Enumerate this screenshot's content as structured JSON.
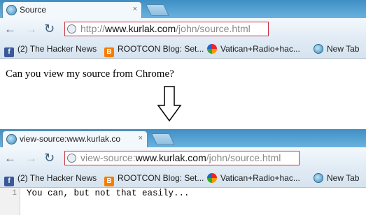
{
  "top_window": {
    "tab": {
      "title": "Source",
      "close": "×"
    },
    "nav": {
      "back": "←",
      "forward": "→",
      "reload": "↻"
    },
    "address": {
      "prefix": "http://",
      "domain": "www.kurlak.com",
      "path": "/john/source.html"
    },
    "bookmarks": [
      {
        "icon": "facebook-icon",
        "label": "(2) The Hacker News"
      },
      {
        "icon": "blogger-icon",
        "label": "ROOTCON Blog: Set..."
      },
      {
        "icon": "picasa-icon",
        "label": "Vatican+Radio+hac..."
      },
      {
        "icon": "globe-icon",
        "label": "New Tab"
      }
    ],
    "page_text": "Can you view my source from Chrome?"
  },
  "bottom_window": {
    "tab": {
      "title": "view-source:www.kurlak.co",
      "close": "×"
    },
    "nav": {
      "back": "←",
      "forward": "→",
      "reload": "↻"
    },
    "address": {
      "prefix": "view-source:",
      "domain": "www.kurlak.com",
      "path": "/john/source.html"
    },
    "bookmarks": [
      {
        "icon": "facebook-icon",
        "label": "(2) The Hacker News"
      },
      {
        "icon": "blogger-icon",
        "label": "ROOTCON Blog: Set..."
      },
      {
        "icon": "picasa-icon",
        "label": "Vatican+Radio+hac..."
      },
      {
        "icon": "globe-icon",
        "label": "New Tab"
      }
    ],
    "source": {
      "line_number": "1",
      "code": "You can, but not that easily..."
    }
  }
}
